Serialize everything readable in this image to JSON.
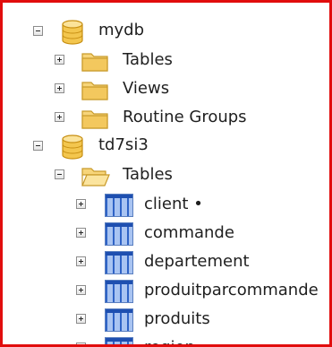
{
  "tree": {
    "databases": [
      {
        "name": "mydb",
        "expanded": true,
        "folders": [
          {
            "label": "Tables",
            "expanded": false
          },
          {
            "label": "Views",
            "expanded": false
          },
          {
            "label": "Routine Groups",
            "expanded": false
          }
        ]
      },
      {
        "name": "td7si3",
        "expanded": true,
        "folders": [
          {
            "label": "Tables",
            "expanded": true,
            "tables": [
              {
                "name": "client",
                "marker": "•"
              },
              {
                "name": "commande"
              },
              {
                "name": "departement"
              },
              {
                "name": "produitparcommande"
              },
              {
                "name": "produits"
              },
              {
                "name": "region"
              }
            ]
          }
        ]
      }
    ]
  },
  "colors": {
    "frame_border": "#e10d0d",
    "folder_fill": "#f7d57a",
    "db_icon_fill": "#f3c64e",
    "table_icon_fill": "#a9c4f2"
  },
  "icons": {
    "collapse": "minus-box-icon",
    "expand": "plus-box-icon",
    "database": "database-cylinder-icon",
    "folder_closed": "folder-icon",
    "folder_open": "open-folder-icon",
    "table": "table-icon"
  }
}
